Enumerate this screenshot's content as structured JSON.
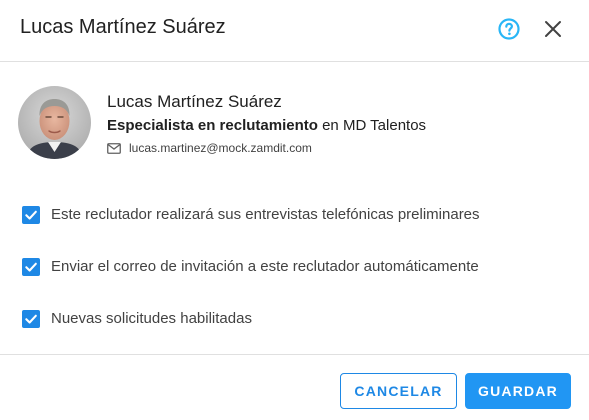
{
  "dialog": {
    "title": "Lucas Martínez Suárez",
    "help_icon": "help-circle-icon",
    "close_icon": "close-icon"
  },
  "profile": {
    "name": "Lucas Martínez Suárez",
    "role": "Especialista en reclutamiento",
    "company_prefix": "en",
    "company": "MD Talentos",
    "email": "lucas.martinez@mock.zamdit.com",
    "email_icon": "mail-icon",
    "avatar": "avatar-photo"
  },
  "options": [
    {
      "label": "Este reclutador realizará sus entrevistas telefónicas preliminares",
      "checked": true
    },
    {
      "label": "Enviar el correo de invitación a este reclutador automáticamente",
      "checked": true
    },
    {
      "label": "Nuevas solicitudes habilitadas",
      "checked": true
    }
  ],
  "footer": {
    "cancel_label": "CANCELAR",
    "save_label": "GUARDAR"
  },
  "colors": {
    "accent": "#1e88e5",
    "help_icon": "#29b6f6",
    "save_button": "#2196f3"
  }
}
